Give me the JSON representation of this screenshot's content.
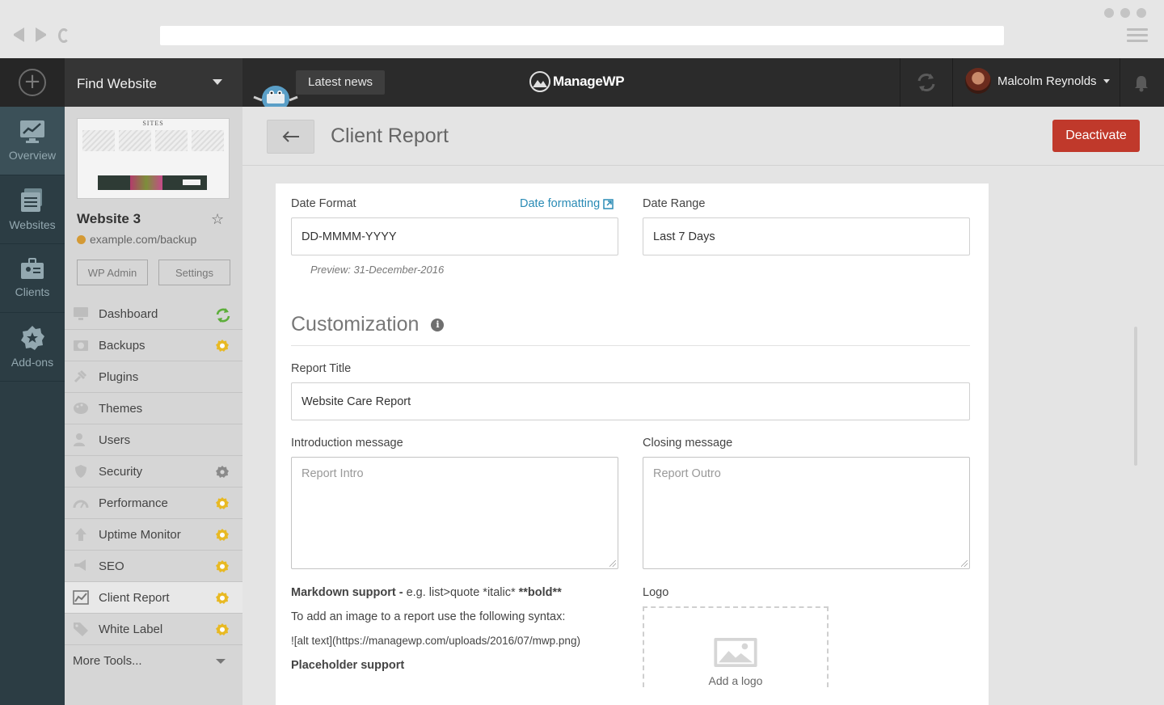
{
  "topbar": {
    "find_website": "Find Website",
    "latest_news": "Latest news",
    "brand": "ManageWP",
    "user_name": "Malcolm Reynolds"
  },
  "iconnav": [
    {
      "label": "Overview"
    },
    {
      "label": "Websites"
    },
    {
      "label": "Clients"
    },
    {
      "label": "Add-ons"
    }
  ],
  "site": {
    "thumb_title": "SITES",
    "name": "Website 3",
    "url": "example.com/backup",
    "wp_admin": "WP Admin",
    "settings": "Settings"
  },
  "menu": [
    {
      "label": "Dashboard",
      "badge": "sync"
    },
    {
      "label": "Backups",
      "badge": "addon"
    },
    {
      "label": "Plugins",
      "badge": ""
    },
    {
      "label": "Themes",
      "badge": ""
    },
    {
      "label": "Users",
      "badge": ""
    },
    {
      "label": "Security",
      "badge": "settings"
    },
    {
      "label": "Performance",
      "badge": "addon"
    },
    {
      "label": "Uptime Monitor",
      "badge": "addon"
    },
    {
      "label": "SEO",
      "badge": "addon"
    },
    {
      "label": "Client Report",
      "badge": "addon",
      "active": true
    },
    {
      "label": "White Label",
      "badge": "addon"
    }
  ],
  "more_tools": "More Tools...",
  "main": {
    "title": "Client Report",
    "deactivate": "Deactivate"
  },
  "form": {
    "date_format_label": "Date Format",
    "date_formatting_link": "Date formatting",
    "date_format_value": "DD-MMMM-YYYY",
    "date_range_label": "Date Range",
    "date_range_value": "Last 7 Days",
    "preview": "Preview: 31-December-2016",
    "customization": "Customization",
    "report_title_label": "Report Title",
    "report_title_value": "Website Care Report",
    "intro_label": "Introduction message",
    "intro_placeholder": "Report Intro",
    "closing_label": "Closing message",
    "closing_placeholder": "Report Outro",
    "markdown_bold": "Markdown support -",
    "markdown_example": " e.g. list>quote *italic* ",
    "markdown_bold_example": "**bold**",
    "image_syntax_intro": "To add an image to a report use the following syntax:",
    "image_syntax": "![alt text](https://managewp.com/uploads/2016/07/mwp.png)",
    "placeholder_support": "Placeholder support",
    "logo_label": "Logo",
    "logo_add": "Add a logo"
  },
  "colors": {
    "accent": "#2a8bb5",
    "danger": "#c0392b",
    "addon_badge": "#e8b923",
    "sync_badge": "#5dae3b",
    "nav_bg": "#2c3d44"
  }
}
